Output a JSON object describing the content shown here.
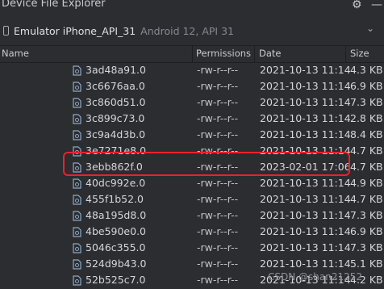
{
  "window": {
    "title": "Device File Explorer",
    "settings_icon": "gear-icon",
    "minimize_icon": "minimize-icon"
  },
  "device": {
    "name": "Emulator iPhone_API_31",
    "api": "Android 12, API 31",
    "icon": "phone-icon"
  },
  "table": {
    "columns": [
      "Name",
      "Permissions",
      "Date",
      "Size"
    ],
    "rows": [
      {
        "name": "3ad48a91.0",
        "perm": "-rw-r--r--",
        "date": "2021-10-13 11:14",
        "size": "4.3 KB"
      },
      {
        "name": "3c6676aa.0",
        "perm": "-rw-r--r--",
        "date": "2021-10-13 11:14",
        "size": "6.9 KB"
      },
      {
        "name": "3c860d51.0",
        "perm": "-rw-r--r--",
        "date": "2021-10-13 11:14",
        "size": "7.3 KB"
      },
      {
        "name": "3c899c73.0",
        "perm": "-rw-r--r--",
        "date": "2021-10-13 11:14",
        "size": "2.8 KB"
      },
      {
        "name": "3c9a4d3b.0",
        "perm": "-rw-r--r--",
        "date": "2021-10-13 11:14",
        "size": "8.4 KB"
      },
      {
        "name": "3e7271e8.0",
        "perm": "-rw-r--r--",
        "date": "2021-10-13 11:14",
        "size": "4.7 KB"
      },
      {
        "name": "3ebb862f.0",
        "perm": "-rw-r--r--",
        "date": "2023-02-01 17:06",
        "size": "4.7 KB"
      },
      {
        "name": "40dc992e.0",
        "perm": "-rw-r--r--",
        "date": "2021-10-13 11:14",
        "size": "4.9 KB"
      },
      {
        "name": "455f1b52.0",
        "perm": "-rw-r--r--",
        "date": "2021-10-13 11:14",
        "size": "4.7 KB"
      },
      {
        "name": "48a195d8.0",
        "perm": "-rw-r--r--",
        "date": "2021-10-13 11:14",
        "size": "7.3 KB"
      },
      {
        "name": "4be590e0.0",
        "perm": "-rw-r--r--",
        "date": "2021-10-13 11:14",
        "size": "6.9 KB"
      },
      {
        "name": "5046c355.0",
        "perm": "-rw-r--r--",
        "date": "2021-10-13 11:14",
        "size": "7.3 KB"
      },
      {
        "name": "524d9b43.0",
        "perm": "-rw-r--r--",
        "date": "2021-10-13 11:14",
        "size": "5.1 KB"
      },
      {
        "name": "52b525c7.0",
        "perm": "-rw-r--r--",
        "date": "2021-10-13 11:14",
        "size": "4.2 KB"
      }
    ],
    "highlight_color": "#e8232a"
  },
  "watermark": "CSDN @shan21252"
}
